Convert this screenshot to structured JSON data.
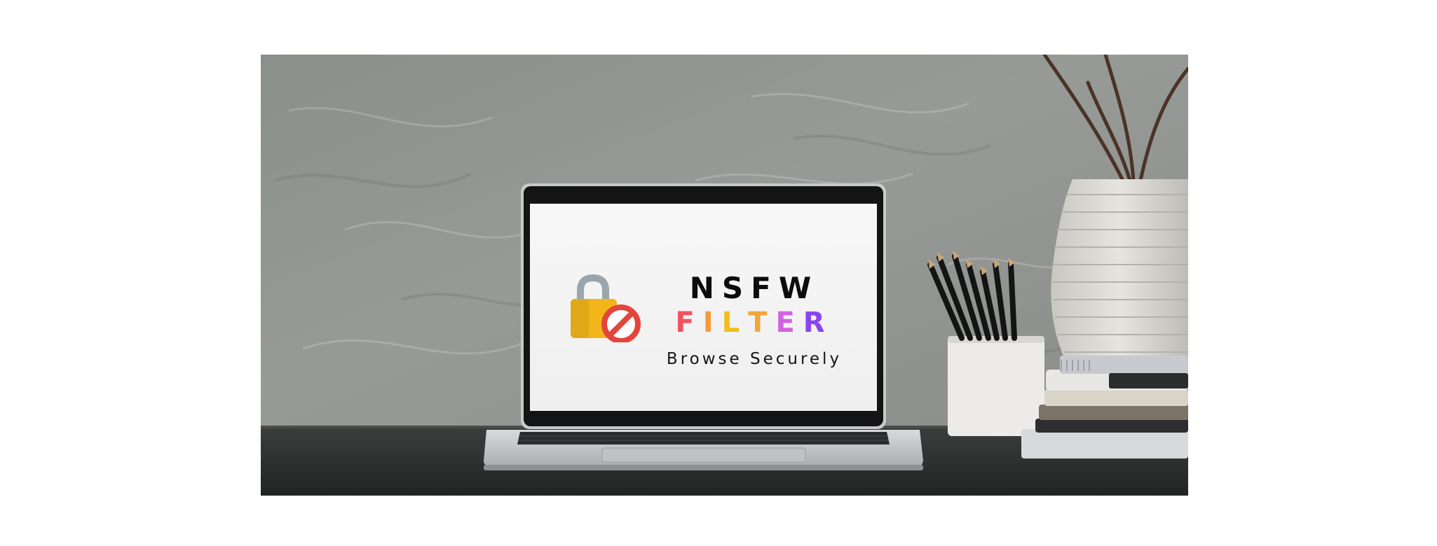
{
  "banner": {
    "title_line1": "NSFW",
    "title_line2_letters": [
      "F",
      "I",
      "L",
      "T",
      "E",
      "R"
    ],
    "title_line2_colors": [
      "#f4515f",
      "#f79a3b",
      "#f2bd1d",
      "#f0a73a",
      "#d362e0",
      "#8a45f2"
    ],
    "tagline": "Browse Securely",
    "lock_icon_colors": {
      "body": "#f2b51a",
      "shackle": "#9aa5ad",
      "block_sign": "#e3453d"
    }
  }
}
